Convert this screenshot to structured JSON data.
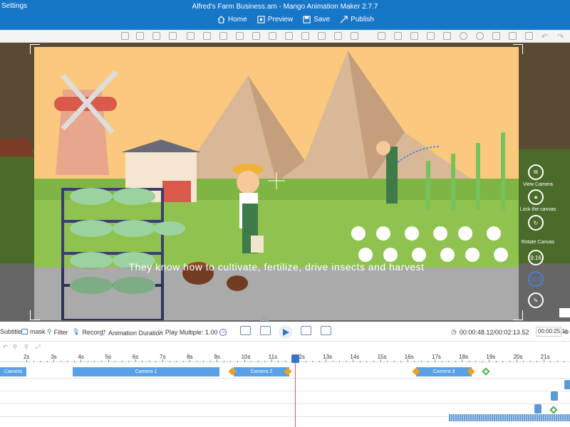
{
  "app": {
    "settings_label": "Settings",
    "window_title": "Alfred's Farm Business.am - Mango Animation Maker 2.7.7"
  },
  "menu": {
    "home": "Home",
    "preview": "Preview",
    "save": "Save",
    "publish": "Publish"
  },
  "stage": {
    "subtitle_text": "They know how to cultivate, fertilize, drive insects and harvest"
  },
  "right_panel": {
    "view_camera": "View Camera",
    "lock_canvas": "Lock the canvas",
    "rotate_canvas": "Rotate Canvas",
    "ratio_916": "9:16",
    "ratio_169": "16:9"
  },
  "controls": {
    "subtitle": "Subtitle",
    "mask": "mask",
    "filter": "Filter",
    "record": "Record",
    "animation_duration": "Animation Duration",
    "play_multiple": "Play Multiple: 1.00",
    "time_display": "00:00:48.12/00:02:13.52",
    "time_input": "00:00:25.1"
  },
  "ruler": {
    "ticks": [
      "2s",
      "3s",
      "4s",
      "5s",
      "6s",
      "7s",
      "8s",
      "9s",
      "10s",
      "11s",
      "12s",
      "13s",
      "14s",
      "15s",
      "16s",
      "17s",
      "18s",
      "19s",
      "20s",
      "21s"
    ]
  },
  "timeline": {
    "camera_clips": [
      "Camera",
      "Camera 1",
      "Camera 2",
      "Camera 3"
    ]
  },
  "colors": {
    "titlebar": "#1676c8",
    "sky": "#fbc97e",
    "camera_clip": "#5aa0e6",
    "keyframe": "#f0a020",
    "playhead": "#e55555"
  }
}
